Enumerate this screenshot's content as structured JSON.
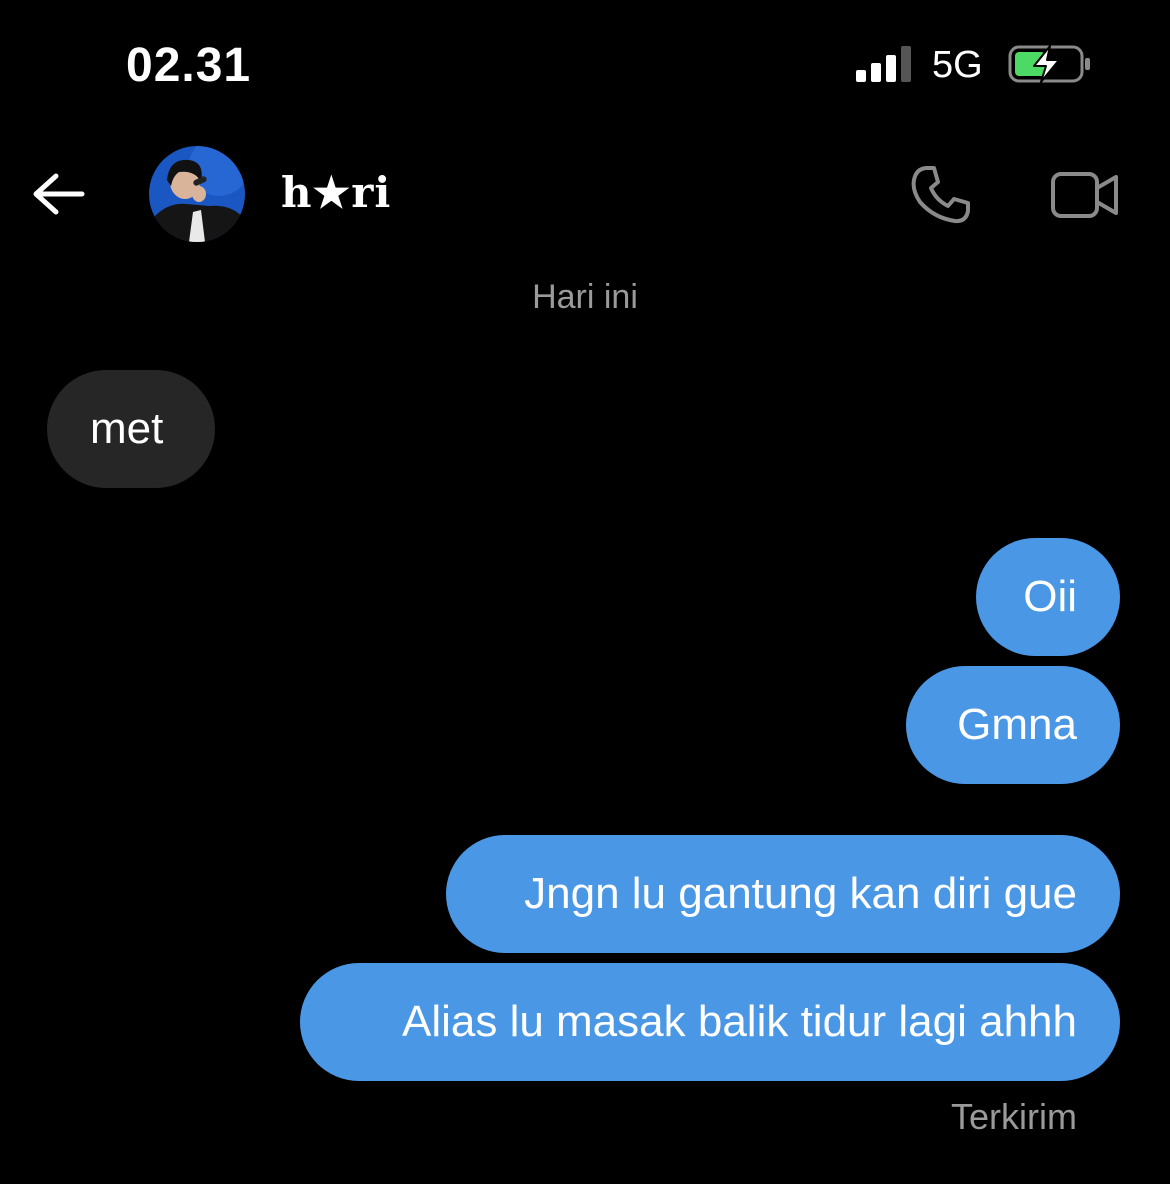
{
  "status_bar": {
    "time": "02.31",
    "network": "5G",
    "colors": {
      "battery_fill": "#4cd964"
    }
  },
  "header": {
    "contact_name": "h★ri",
    "icons": {
      "back": "arrow-left-icon",
      "call": "phone-icon",
      "video": "video-camera-icon"
    }
  },
  "conversation": {
    "date_divider": "Hari ini",
    "incoming": [
      {
        "text": "met"
      }
    ],
    "outgoing": [
      {
        "text": "Oii"
      },
      {
        "text": "Gmna"
      },
      {
        "text": "Jngn lu gantung kan diri gue"
      },
      {
        "text": "Alias lu masak balik tidur lagi ahhh"
      }
    ],
    "delivery_status": "Terkirim"
  },
  "colors": {
    "background": "#000000",
    "incoming_bubble": "#262626",
    "outgoing_bubble": "#4a97e6",
    "muted_text": "#9a9a9a"
  }
}
